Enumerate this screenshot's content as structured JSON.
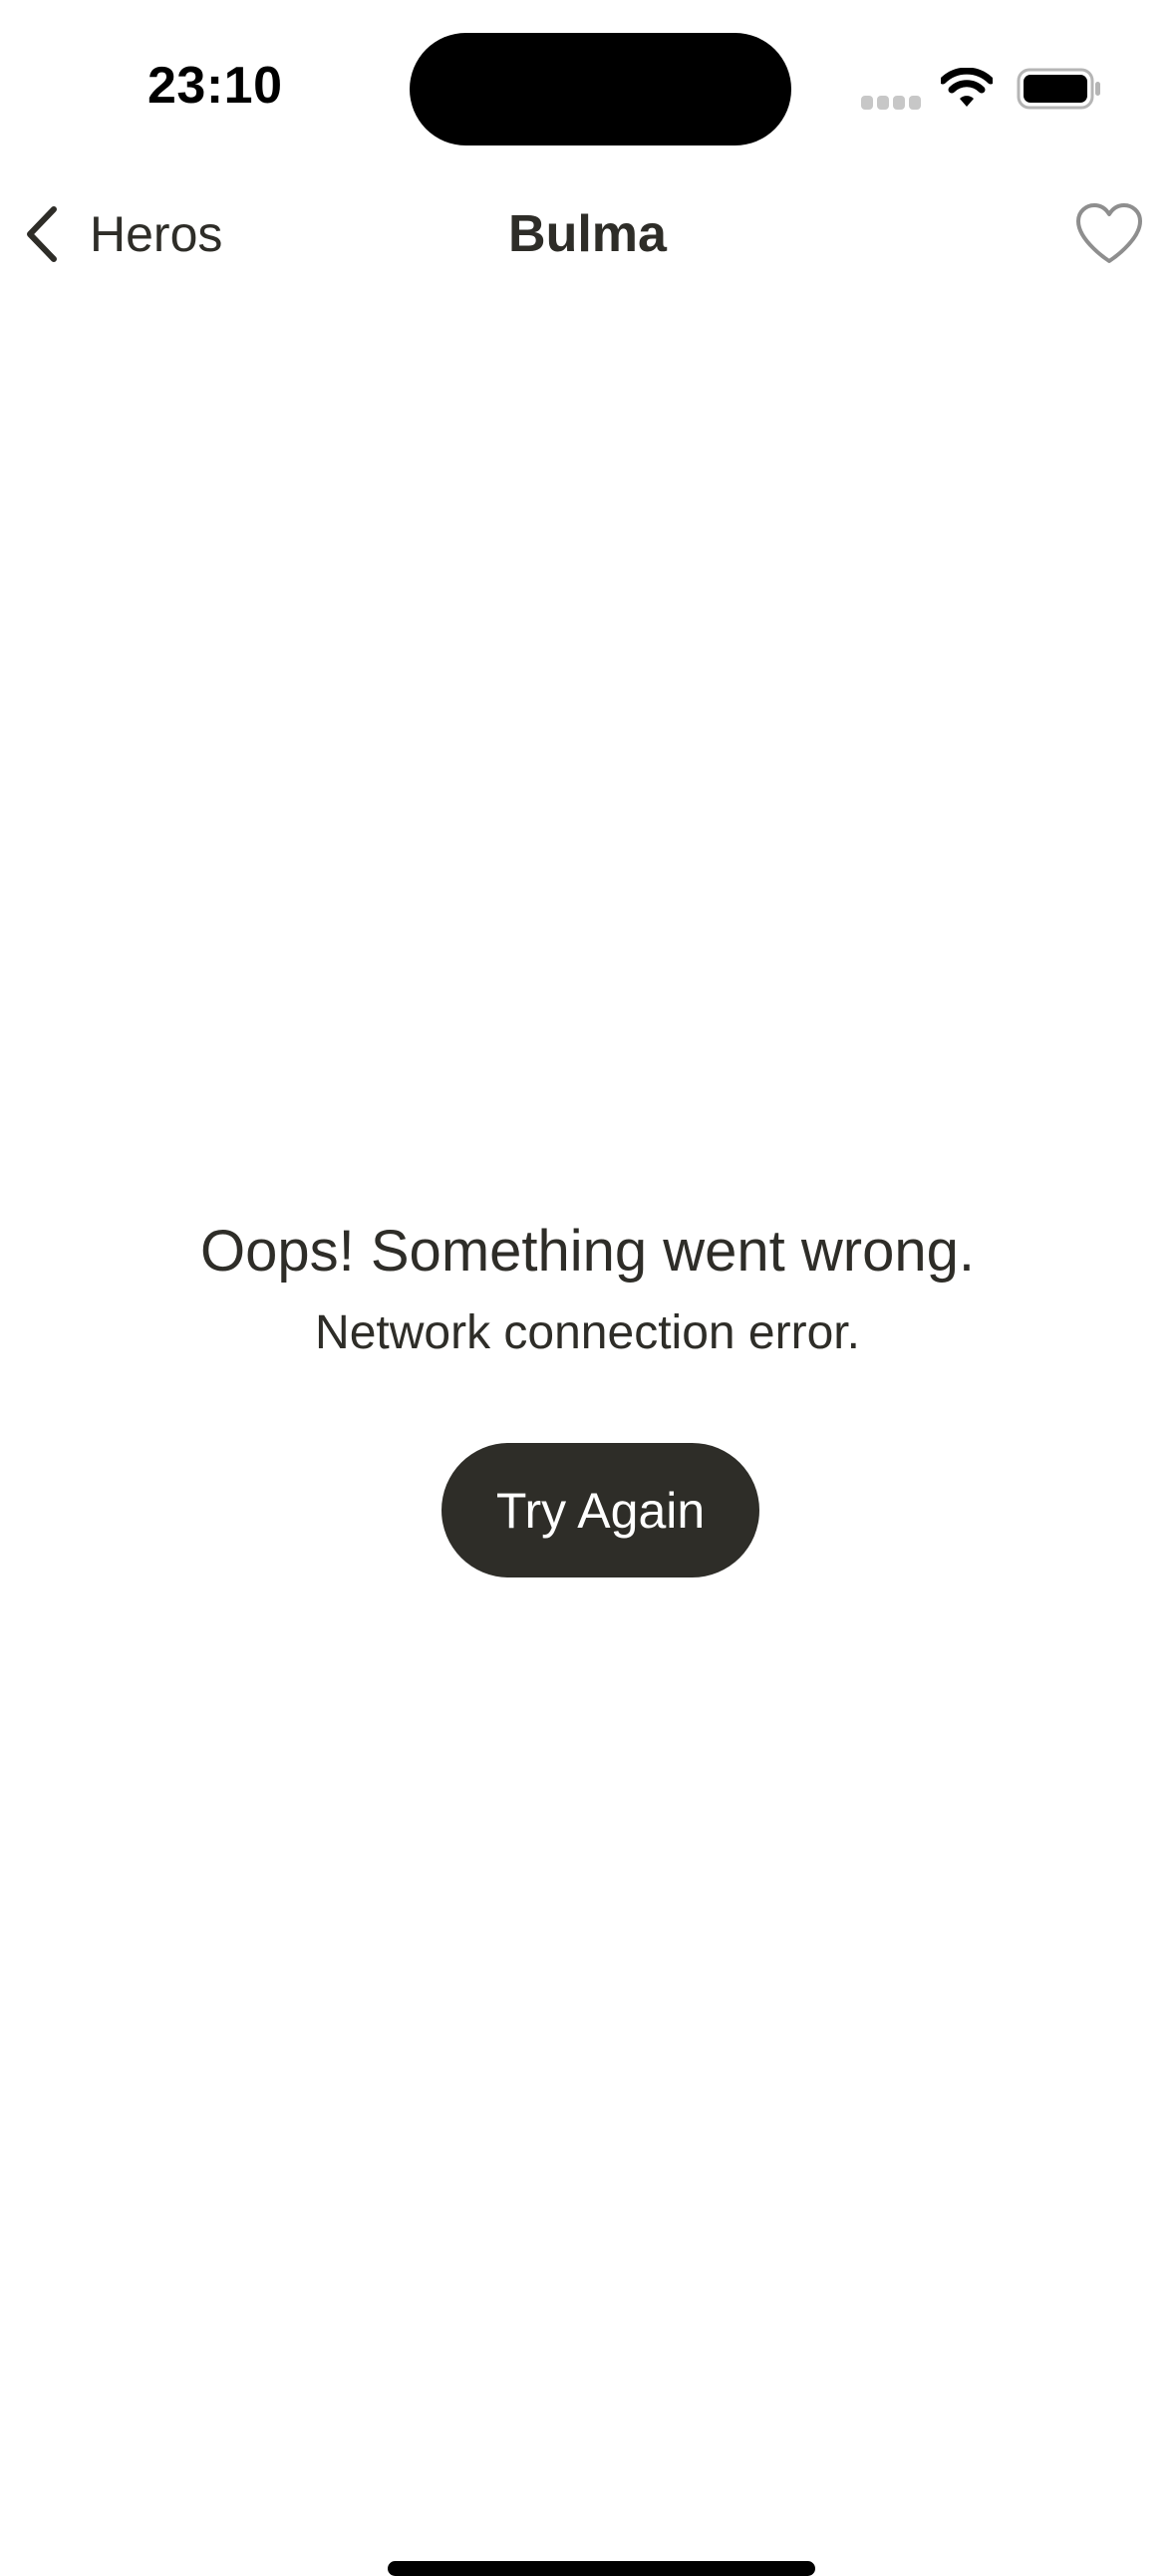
{
  "status_bar": {
    "time": "23:10"
  },
  "nav": {
    "back_label": "Heros",
    "title": "Bulma",
    "favorite_icon": "heart-outline-icon"
  },
  "error": {
    "title": "Oops! Something went wrong.",
    "message": "Network connection error.",
    "retry_label": "Try Again"
  },
  "colors": {
    "text": "#2e2d28",
    "button_bg": "#2e2d28",
    "button_text": "#ffffff",
    "favorite_outline": "#8e8e8e",
    "background": "#ffffff"
  }
}
